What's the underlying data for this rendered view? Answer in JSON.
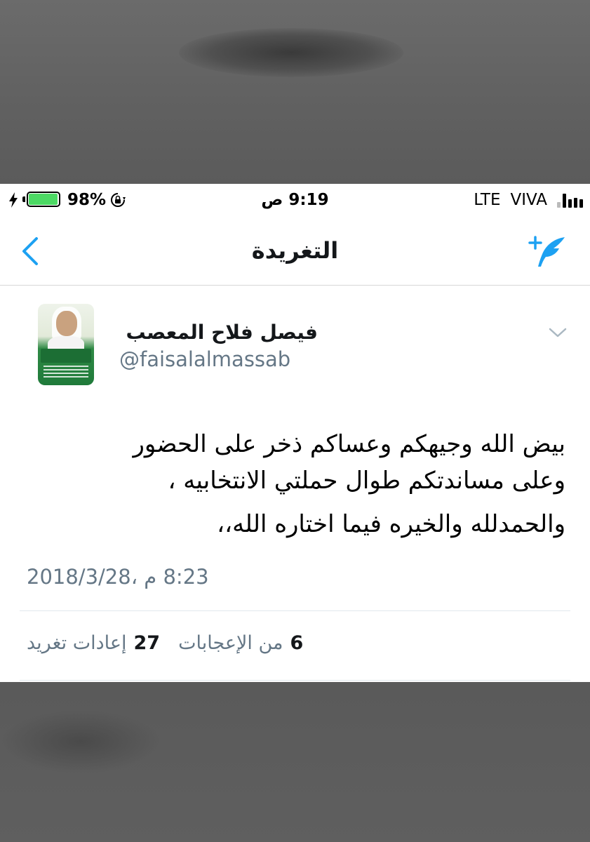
{
  "status_bar": {
    "battery_percent": "98%",
    "battery_level": 0.98,
    "time": "9:19 ص",
    "network": "LTE",
    "carrier": "VIVA",
    "signal_bars": 4
  },
  "nav": {
    "title": "التغريدة"
  },
  "tweet": {
    "author_name": "فيصل فلاح المعصب",
    "author_handle": "@faisalalmassab",
    "text_lines": [
      "بيض الله وجيهكم وعساكم ذخر على الحضور",
      "وعلى مساندتكم طوال حملتي الانتخابيه ،",
      "والحمدلله والخيره فيما اختاره الله،،"
    ],
    "timestamp": "8:23 م ،2018/3/28",
    "likes_count": "6",
    "likes_label": "من الإعجابات",
    "retweets_count": "27",
    "retweets_label": "إعادات تغريد"
  },
  "colors": {
    "accent": "#1da1f2",
    "secondary_text": "#657786",
    "battery": "#4cd964"
  },
  "icons": {
    "back": "chevron-left-icon",
    "compose": "compose-tweet-icon",
    "caret": "chevron-down-icon",
    "charging": "bolt-icon",
    "rotation_lock": "rotation-lock-icon"
  }
}
